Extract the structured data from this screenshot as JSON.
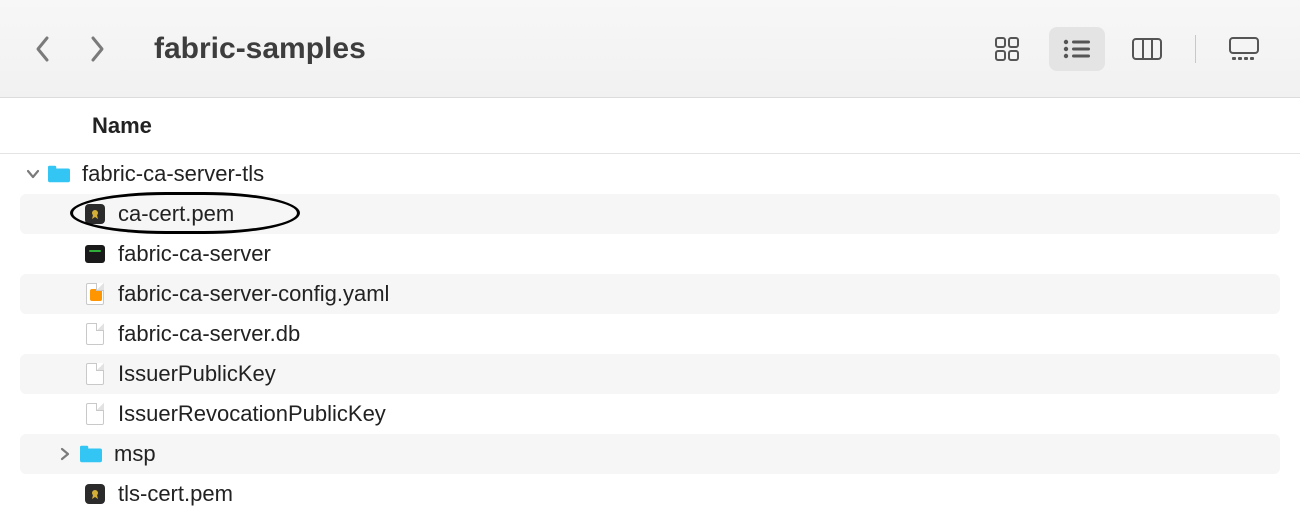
{
  "toolbar": {
    "title": "fabric-samples"
  },
  "columns": {
    "name": "Name"
  },
  "tree": {
    "root": {
      "name": "fabric-ca-server-tls",
      "expanded": true
    },
    "items": [
      {
        "name": "ca-cert.pem",
        "icon": "cert",
        "circled": true
      },
      {
        "name": "fabric-ca-server",
        "icon": "exec"
      },
      {
        "name": "fabric-ca-server-config.yaml",
        "icon": "sublime"
      },
      {
        "name": "fabric-ca-server.db",
        "icon": "blank"
      },
      {
        "name": "IssuerPublicKey",
        "icon": "blank"
      },
      {
        "name": "IssuerRevocationPublicKey",
        "icon": "blank"
      },
      {
        "name": "msp",
        "icon": "folder",
        "disclosure": "collapsed"
      },
      {
        "name": "tls-cert.pem",
        "icon": "cert"
      }
    ]
  }
}
